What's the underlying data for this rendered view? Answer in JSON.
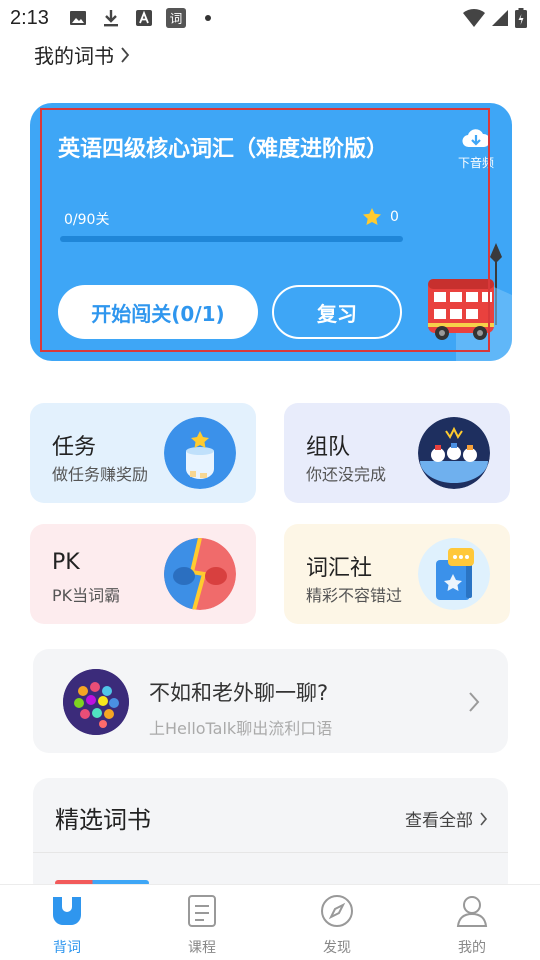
{
  "status_bar": {
    "time": "2:13"
  },
  "my_book": {
    "label": "我的词书"
  },
  "book_card": {
    "title": "英语四级核心词汇（难度进阶版）",
    "download_label": "下音频",
    "progress_text": "0/90关",
    "progress_fraction": 0,
    "stars": "0",
    "start_button": "开始闯关(0/1)",
    "review_button": "复习"
  },
  "tiles": [
    {
      "title": "任务",
      "subtitle": "做任务赚奖励",
      "bg": "#e3f1fd"
    },
    {
      "title": "组队",
      "subtitle": "你还没完成",
      "bg": "#e8ecfb"
    },
    {
      "title": "PK",
      "subtitle": "PK当词霸",
      "bg": "#fdecee"
    },
    {
      "title": "词汇社",
      "subtitle": "精彩不容错过",
      "bg": "#fdf6e6"
    }
  ],
  "banner": {
    "title": "不如和老外聊一聊?",
    "subtitle": "上HelloTalk聊出流利口语"
  },
  "featured": {
    "title": "精选词书",
    "view_all": "查看全部"
  },
  "bottom_nav": [
    {
      "label": "背词",
      "icon": "recite-icon",
      "active": true
    },
    {
      "label": "课程",
      "icon": "course-icon",
      "active": false
    },
    {
      "label": "发现",
      "icon": "compass-icon",
      "active": false
    },
    {
      "label": "我的",
      "icon": "profile-icon",
      "active": false
    }
  ],
  "colors": {
    "accent": "#2f96ee",
    "card": "#3ea6f6"
  }
}
